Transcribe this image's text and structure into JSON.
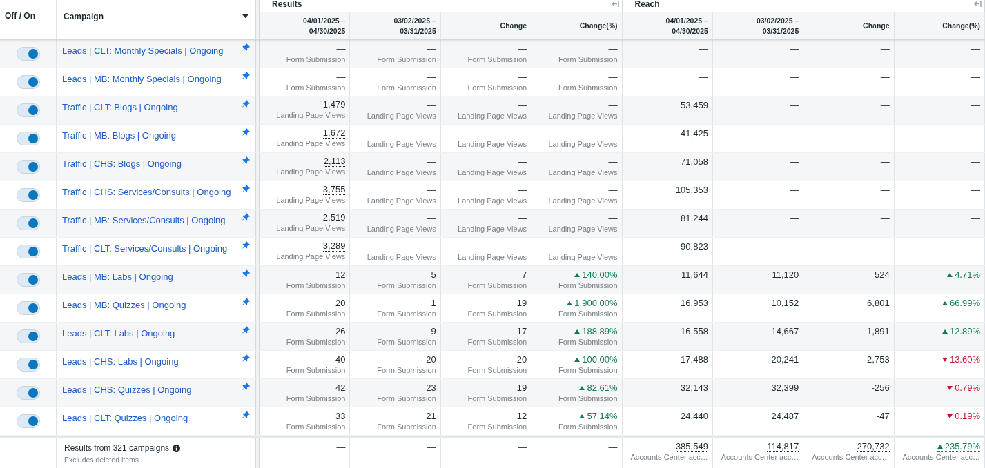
{
  "header": {
    "toggle_column": "Off / On",
    "campaign_column": "Campaign",
    "groups": [
      {
        "title": "Results",
        "columns": [
          "04/01/2025 –\n04/30/2025",
          "03/02/2025 –\n03/31/2025",
          "Change",
          "Change(%)"
        ]
      },
      {
        "title": "Reach",
        "columns": [
          "04/01/2025 –\n04/30/2025",
          "03/02/2025 –\n03/31/2025",
          "Change",
          "Change(%)"
        ]
      }
    ]
  },
  "rows": [
    {
      "on": true,
      "campaign": "Leads | CLT: Monthly Specials | Ongoing",
      "pinned": true,
      "results": [
        {
          "value": "—",
          "unit": "Form Submission",
          "dotted": false
        },
        {
          "value": "—",
          "unit": "Form Submission",
          "dotted": false
        },
        {
          "value": "—",
          "unit": "Form Submission",
          "dotted": false
        },
        {
          "value": "—",
          "unit": "Form Submission",
          "dotted": false
        }
      ],
      "reach": [
        {
          "value": "—"
        },
        {
          "value": "—"
        },
        {
          "value": "—"
        },
        {
          "value": "—"
        }
      ]
    },
    {
      "on": true,
      "campaign": "Leads | MB: Monthly Specials | Ongoing",
      "pinned": true,
      "results": [
        {
          "value": "—",
          "unit": "Form Submission",
          "dotted": false
        },
        {
          "value": "—",
          "unit": "Form Submission",
          "dotted": false
        },
        {
          "value": "—",
          "unit": "Form Submission",
          "dotted": false
        },
        {
          "value": "—",
          "unit": "Form Submission",
          "dotted": false
        }
      ],
      "reach": [
        {
          "value": "—"
        },
        {
          "value": "—"
        },
        {
          "value": "—"
        },
        {
          "value": "—"
        }
      ]
    },
    {
      "on": true,
      "campaign": "Traffic | CLT: Blogs | Ongoing",
      "pinned": true,
      "results": [
        {
          "value": "1,479",
          "unit": "Landing Page Views",
          "dotted": true
        },
        {
          "value": "—",
          "unit": "Landing Page Views",
          "dotted": false
        },
        {
          "value": "—",
          "unit": "Landing Page Views",
          "dotted": false
        },
        {
          "value": "—",
          "unit": "Landing Page Views",
          "dotted": false
        }
      ],
      "reach": [
        {
          "value": "53,459"
        },
        {
          "value": "—"
        },
        {
          "value": "—"
        },
        {
          "value": "—"
        }
      ]
    },
    {
      "on": true,
      "campaign": "Traffic | MB: Blogs | Ongoing",
      "pinned": true,
      "results": [
        {
          "value": "1,672",
          "unit": "Landing Page Views",
          "dotted": true
        },
        {
          "value": "—",
          "unit": "Landing Page Views",
          "dotted": false
        },
        {
          "value": "—",
          "unit": "Landing Page Views",
          "dotted": false
        },
        {
          "value": "—",
          "unit": "Landing Page Views",
          "dotted": false
        }
      ],
      "reach": [
        {
          "value": "41,425"
        },
        {
          "value": "—"
        },
        {
          "value": "—"
        },
        {
          "value": "—"
        }
      ]
    },
    {
      "on": true,
      "campaign": "Traffic | CHS: Blogs | Ongoing",
      "pinned": true,
      "results": [
        {
          "value": "2,113",
          "unit": "Landing Page Views",
          "dotted": true
        },
        {
          "value": "—",
          "unit": "Landing Page Views",
          "dotted": false
        },
        {
          "value": "—",
          "unit": "Landing Page Views",
          "dotted": false
        },
        {
          "value": "—",
          "unit": "Landing Page Views",
          "dotted": false
        }
      ],
      "reach": [
        {
          "value": "71,058"
        },
        {
          "value": "—"
        },
        {
          "value": "—"
        },
        {
          "value": "—"
        }
      ]
    },
    {
      "on": true,
      "campaign": "Traffic | CHS: Services/Consults | Ongoing",
      "pinned": true,
      "results": [
        {
          "value": "3,755",
          "unit": "Landing Page Views",
          "dotted": true
        },
        {
          "value": "—",
          "unit": "Landing Page Views",
          "dotted": false
        },
        {
          "value": "—",
          "unit": "Landing Page Views",
          "dotted": false
        },
        {
          "value": "—",
          "unit": "Landing Page Views",
          "dotted": false
        }
      ],
      "reach": [
        {
          "value": "105,353"
        },
        {
          "value": "—"
        },
        {
          "value": "—"
        },
        {
          "value": "—"
        }
      ]
    },
    {
      "on": true,
      "campaign": "Traffic | MB: Services/Consults | Ongoing",
      "pinned": true,
      "results": [
        {
          "value": "2,519",
          "unit": "Landing Page Views",
          "dotted": true
        },
        {
          "value": "—",
          "unit": "Landing Page Views",
          "dotted": false
        },
        {
          "value": "—",
          "unit": "Landing Page Views",
          "dotted": false
        },
        {
          "value": "—",
          "unit": "Landing Page Views",
          "dotted": false
        }
      ],
      "reach": [
        {
          "value": "81,244"
        },
        {
          "value": "—"
        },
        {
          "value": "—"
        },
        {
          "value": "—"
        }
      ]
    },
    {
      "on": true,
      "campaign": "Traffic | CLT: Services/Consults | Ongoing",
      "pinned": true,
      "results": [
        {
          "value": "3,289",
          "unit": "Landing Page Views",
          "dotted": true
        },
        {
          "value": "—",
          "unit": "Landing Page Views",
          "dotted": false
        },
        {
          "value": "—",
          "unit": "Landing Page Views",
          "dotted": false
        },
        {
          "value": "—",
          "unit": "Landing Page Views",
          "dotted": false
        }
      ],
      "reach": [
        {
          "value": "90,823"
        },
        {
          "value": "—"
        },
        {
          "value": "—"
        },
        {
          "value": "—"
        }
      ]
    },
    {
      "on": true,
      "campaign": "Leads | MB: Labs | Ongoing",
      "pinned": true,
      "results": [
        {
          "value": "12",
          "unit": "Form Submission",
          "dotted": false
        },
        {
          "value": "5",
          "unit": "Form Submission",
          "dotted": false
        },
        {
          "value": "7",
          "unit": "Form Submission",
          "dotted": false
        },
        {
          "value": "140.00%",
          "unit": "Form Submission",
          "dotted": false,
          "increase": true
        }
      ],
      "reach": [
        {
          "value": "11,644"
        },
        {
          "value": "11,120"
        },
        {
          "value": "524"
        },
        {
          "value": "4.71%",
          "increase": true
        }
      ]
    },
    {
      "on": true,
      "campaign": "Leads | MB: Quizzes | Ongoing",
      "pinned": true,
      "results": [
        {
          "value": "20",
          "unit": "Form Submission",
          "dotted": false
        },
        {
          "value": "1",
          "unit": "Form Submission",
          "dotted": false
        },
        {
          "value": "19",
          "unit": "Form Submission",
          "dotted": false
        },
        {
          "value": "1,900.00%",
          "unit": "Form Submission",
          "dotted": false,
          "increase": true
        }
      ],
      "reach": [
        {
          "value": "16,953"
        },
        {
          "value": "10,152"
        },
        {
          "value": "6,801"
        },
        {
          "value": "66.99%",
          "increase": true
        }
      ]
    },
    {
      "on": true,
      "campaign": "Leads | CLT: Labs | Ongoing",
      "pinned": true,
      "results": [
        {
          "value": "26",
          "unit": "Form Submission",
          "dotted": false
        },
        {
          "value": "9",
          "unit": "Form Submission",
          "dotted": false
        },
        {
          "value": "17",
          "unit": "Form Submission",
          "dotted": false
        },
        {
          "value": "188.89%",
          "unit": "Form Submission",
          "dotted": false,
          "increase": true
        }
      ],
      "reach": [
        {
          "value": "16,558"
        },
        {
          "value": "14,667"
        },
        {
          "value": "1,891"
        },
        {
          "value": "12.89%",
          "increase": true
        }
      ]
    },
    {
      "on": true,
      "campaign": "Leads | CHS: Labs | Ongoing",
      "pinned": true,
      "results": [
        {
          "value": "40",
          "unit": "Form Submission",
          "dotted": false
        },
        {
          "value": "20",
          "unit": "Form Submission",
          "dotted": false
        },
        {
          "value": "20",
          "unit": "Form Submission",
          "dotted": false
        },
        {
          "value": "100.00%",
          "unit": "Form Submission",
          "dotted": false,
          "increase": true
        }
      ],
      "reach": [
        {
          "value": "17,488"
        },
        {
          "value": "20,241"
        },
        {
          "value": "-2,753"
        },
        {
          "value": "13.60%",
          "increase": false
        }
      ]
    },
    {
      "on": true,
      "campaign": "Leads | CHS: Quizzes | Ongoing",
      "pinned": true,
      "results": [
        {
          "value": "42",
          "unit": "Form Submission",
          "dotted": false
        },
        {
          "value": "23",
          "unit": "Form Submission",
          "dotted": false
        },
        {
          "value": "19",
          "unit": "Form Submission",
          "dotted": false
        },
        {
          "value": "82.61%",
          "unit": "Form Submission",
          "dotted": false,
          "increase": true
        }
      ],
      "reach": [
        {
          "value": "32,143"
        },
        {
          "value": "32,399"
        },
        {
          "value": "-256"
        },
        {
          "value": "0.79%",
          "increase": false
        }
      ]
    },
    {
      "on": true,
      "campaign": "Leads | CLT: Quizzes | Ongoing",
      "pinned": true,
      "results": [
        {
          "value": "33",
          "unit": "Form Submission",
          "dotted": false
        },
        {
          "value": "21",
          "unit": "Form Submission",
          "dotted": false
        },
        {
          "value": "12",
          "unit": "Form Submission",
          "dotted": false
        },
        {
          "value": "57.14%",
          "unit": "Form Submission",
          "dotted": false,
          "increase": true
        }
      ],
      "reach": [
        {
          "value": "24,440"
        },
        {
          "value": "24,487"
        },
        {
          "value": "-47"
        },
        {
          "value": "0.19%",
          "increase": false
        }
      ]
    }
  ],
  "footer": {
    "title": "Results from 321 campaigns",
    "note": "Excludes deleted items",
    "results": [
      "—",
      "—",
      "—",
      "—"
    ],
    "reach": [
      {
        "value": "385,549",
        "unit": "Accounts Center acc…"
      },
      {
        "value": "114,817",
        "unit": "Accounts Center acc…"
      },
      {
        "value": "270,732",
        "unit": "Accounts Center acc…"
      },
      {
        "value": "235.79%",
        "unit": "Accounts Center acc…",
        "increase": true
      }
    ]
  }
}
